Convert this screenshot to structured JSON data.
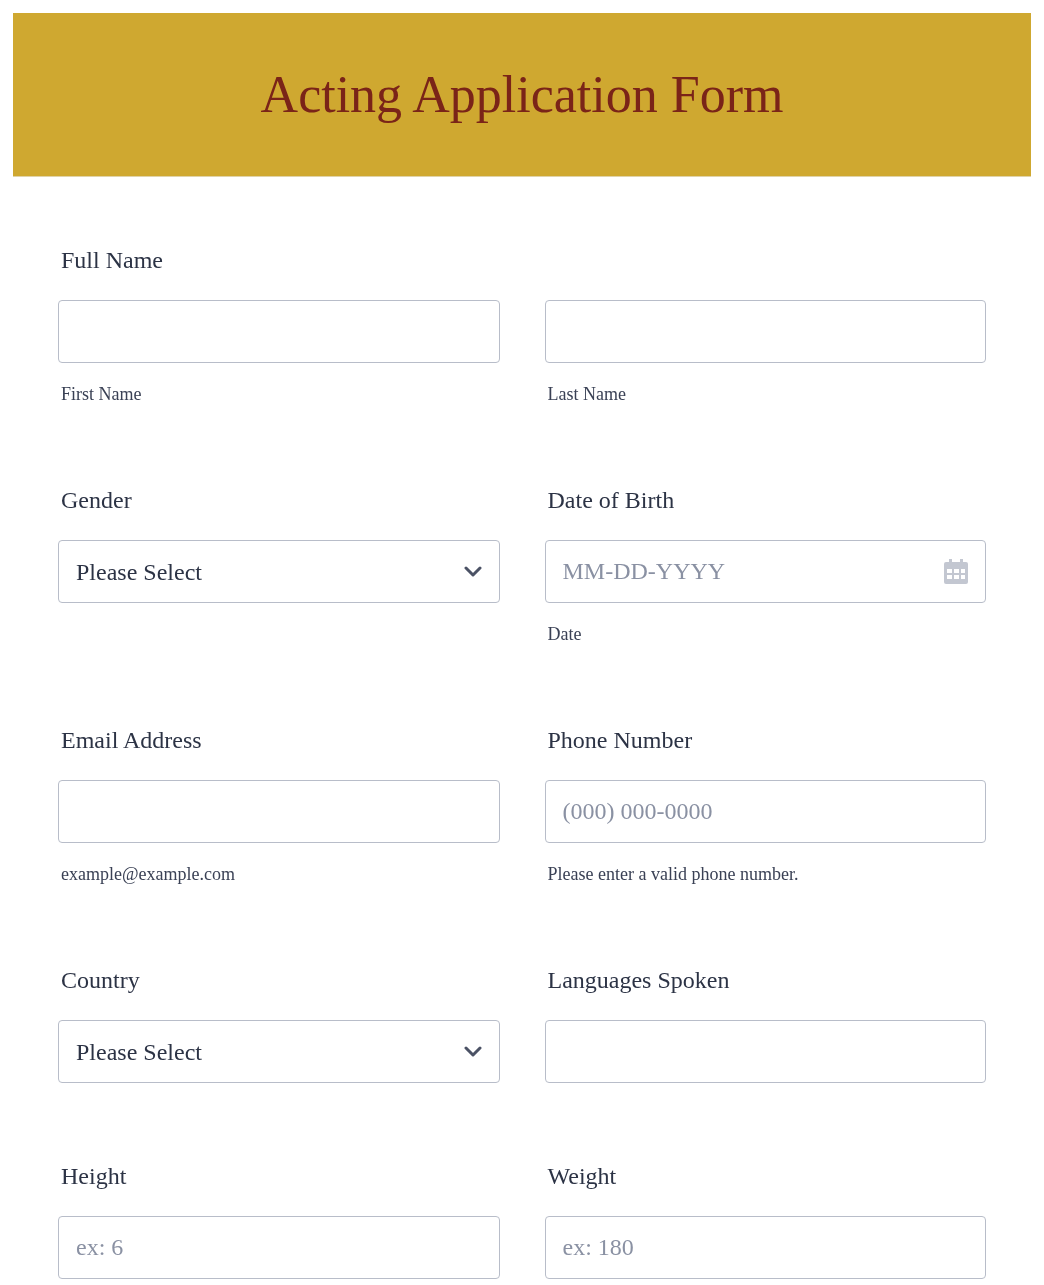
{
  "header": {
    "title": "Acting Application Form"
  },
  "rows": [
    {
      "label": "Full Name",
      "cells": [
        {
          "kind": "text",
          "sublabel": "First Name"
        },
        {
          "kind": "text",
          "sublabel": "Last Name"
        }
      ]
    },
    {
      "cells": [
        {
          "label": "Gender",
          "kind": "select",
          "value": "Please Select"
        },
        {
          "label": "Date of Birth",
          "kind": "date",
          "placeholder": "MM-DD-YYYY",
          "sublabel": "Date"
        }
      ]
    },
    {
      "cells": [
        {
          "label": "Email Address",
          "kind": "text",
          "sublabel": "example@example.com"
        },
        {
          "label": "Phone Number",
          "kind": "text",
          "placeholder": "(000) 000-0000",
          "sublabel": "Please enter a valid phone number."
        }
      ]
    },
    {
      "cells": [
        {
          "label": "Country",
          "kind": "select",
          "value": "Please Select"
        },
        {
          "label": "Languages Spoken",
          "kind": "text"
        }
      ]
    },
    {
      "cells": [
        {
          "label": "Height",
          "kind": "text",
          "placeholder": "ex: 6"
        },
        {
          "label": "Weight",
          "kind": "text",
          "placeholder": "ex: 180"
        }
      ]
    }
  ]
}
